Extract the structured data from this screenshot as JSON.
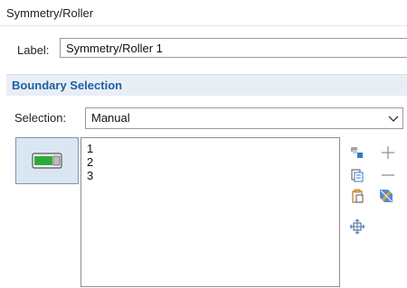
{
  "title": "Symmetry/Roller",
  "label": {
    "caption": "Label:",
    "value": "Symmetry/Roller 1"
  },
  "section": {
    "title": "Boundary Selection"
  },
  "selection": {
    "caption": "Selection:",
    "value": "Manual"
  },
  "list": {
    "items": [
      "1",
      "2",
      "3"
    ]
  },
  "icons": {
    "toggle": "active-toggle-icon",
    "toolbar": [
      "select-boundaries-icon",
      "add-icon",
      "paste-selection-icon",
      "remove-icon",
      "copy-selection-icon",
      "clear-selection-icon",
      "zoom-to-selection-icon"
    ]
  },
  "colors": {
    "section_title": "#1f5fa3",
    "section_bg": "#e9eef6",
    "toggle_green": "#2eaa3c"
  }
}
